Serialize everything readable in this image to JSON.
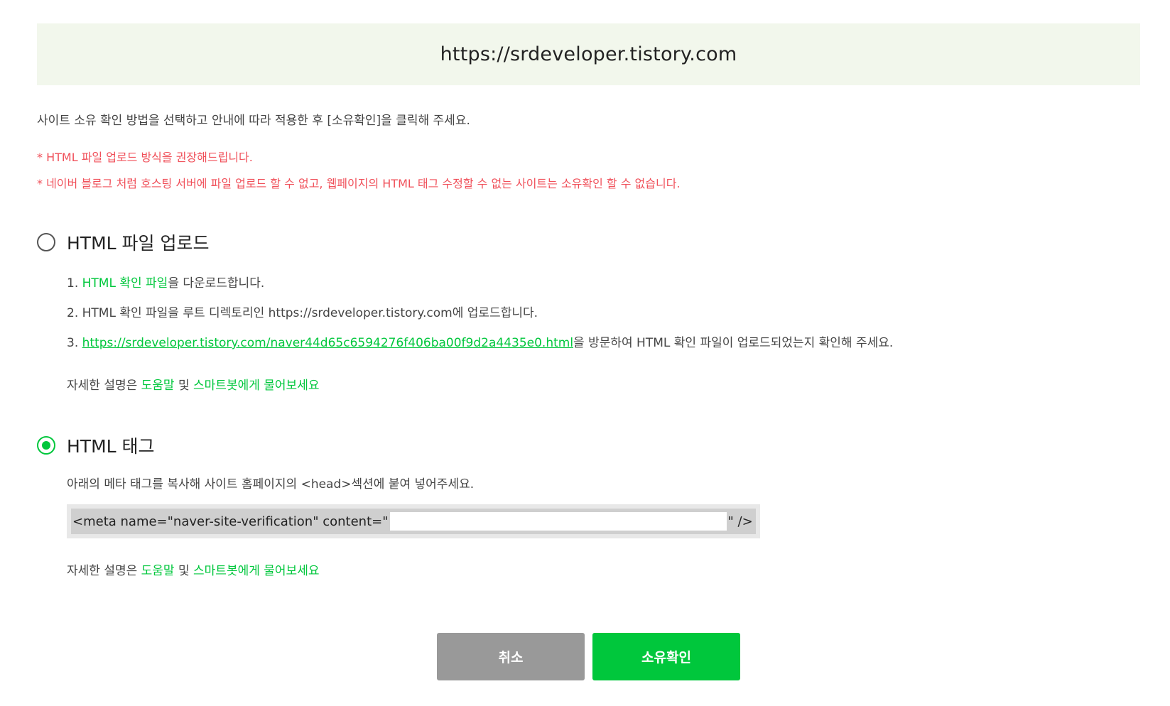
{
  "banner": {
    "site_url": "https://srdeveloper.tistory.com"
  },
  "instruction": "사이트 소유 확인 방법을 선택하고 안내에 따라 적용한 후 [소유확인]을 클릭해 주세요.",
  "notices": [
    "* HTML 파일 업로드 방식을 권장해드립니다.",
    "* 네이버 블로그 처럼 호스팅 서버에 파일 업로드 할 수 없고, 웹페이지의 HTML 태그 수정할 수 없는 사이트는 소유확인 할 수 없습니다."
  ],
  "option_upload": {
    "label": "HTML 파일 업로드",
    "selected": false,
    "step1": {
      "prefix": "1. ",
      "link": "HTML 확인 파일",
      "suffix": "을 다운로드합니다."
    },
    "step2": "2. HTML 확인 파일을 루트 디렉토리인 https://srdeveloper.tistory.com에 업로드합니다.",
    "step3": {
      "prefix": "3. ",
      "link": "https://srdeveloper.tistory.com/naver44d65c6594276f406ba00f9d2a4435e0.html",
      "suffix": "을 방문하여 HTML 확인 파일이 업로드되었는지 확인해 주세요."
    },
    "help": {
      "prefix": "자세한 설명은 ",
      "help_link": "도움말",
      "middle": " 및 ",
      "bot_link": "스마트봇에게 물어보세요"
    }
  },
  "option_tag": {
    "label": "HTML 태그",
    "selected": true,
    "description": "아래의 메타 태그를 복사해 사이트 홈페이지의 <head>섹션에 붙여 넣어주세요.",
    "meta_prefix": "<meta name=\"naver-site-verification\" content=\"",
    "meta_suffix": "\" />",
    "help": {
      "prefix": "자세한 설명은 ",
      "help_link": "도움말",
      "middle": " 및 ",
      "bot_link": "스마트봇에게 물어보세요"
    }
  },
  "buttons": {
    "cancel": "취소",
    "confirm": "소유확인"
  },
  "colors": {
    "accent": "#00c73c",
    "warning": "#f0505a",
    "banner_bg": "#f2f7ec",
    "cancel_bg": "#999999"
  }
}
